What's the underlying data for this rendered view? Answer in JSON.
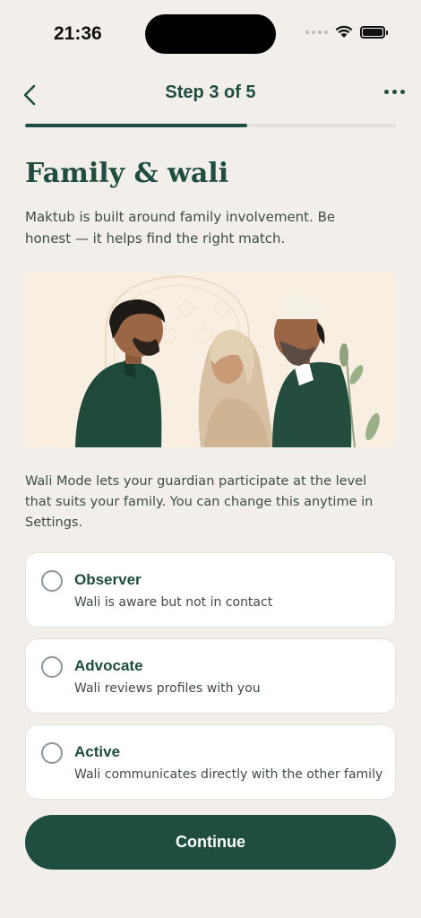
{
  "status": {
    "time": "21:36"
  },
  "nav": {
    "step_label": "Step 3 of 5"
  },
  "progress": {
    "fraction": 0.6
  },
  "page": {
    "title": "Family & wali",
    "intro": "Maktub is built around family involvement. Be honest — it helps find the right match.",
    "wali_description": "Wali Mode lets your guardian participate at the level that suits your family. You can change this anytime in Settings."
  },
  "options": [
    {
      "title": "Observer",
      "subtitle": "Wali is aware but not in contact",
      "selected": false
    },
    {
      "title": "Advocate",
      "subtitle": "Wali reviews profiles with you",
      "selected": false
    },
    {
      "title": "Active",
      "subtitle": "Wali communicates directly with the other family",
      "selected": false
    }
  ],
  "continue_label": "Continue",
  "colors": {
    "primary": "#1f4d3f",
    "background": "#f2efea",
    "card": "#ffffff"
  }
}
